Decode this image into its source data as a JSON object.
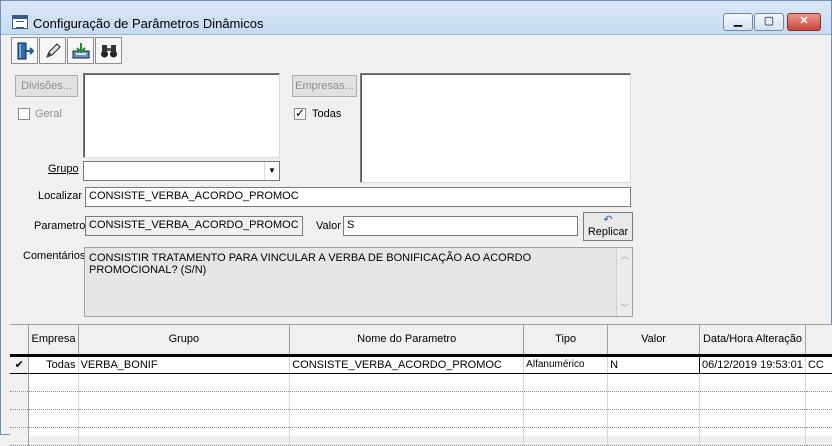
{
  "window": {
    "title": "Configuração de Parâmetros Dinâmicos",
    "min_label": "▁",
    "max_label": "▢",
    "close_label": "✕"
  },
  "toolbar": {
    "buttons": [
      {
        "icon": "exit-door-icon"
      },
      {
        "icon": "pencil-icon"
      },
      {
        "icon": "save-tray-icon"
      },
      {
        "icon": "binoculars-icon"
      }
    ]
  },
  "filters": {
    "divisoes_button": "Divisões...",
    "geral_label": "Geral",
    "geral_checked": false,
    "empresas_button": "Empresas...",
    "todas_label": "Todas",
    "todas_checked": true,
    "grupo_label": "Grupo",
    "grupo_value": "",
    "localizar_label": "Localizar",
    "localizar_value": "CONSISTE_VERBA_ACORDO_PROMOC",
    "parametro_label": "Parametro",
    "parametro_value": "CONSISTE_VERBA_ACORDO_PROMOC",
    "valor_label": "Valor",
    "valor_value": "S",
    "replicar_label": "Replicar",
    "comentarios_label": "Comentários",
    "comentarios_value": "CONSISTIR TRATAMENTO PARA VINCULAR A VERBA DE BONIFICAÇÃO AO ACORDO PROMOCIONAL? (S/N)"
  },
  "grid": {
    "columns": [
      "Empresa",
      "Grupo",
      "Nome do Parametro",
      "Tipo",
      "Valor",
      "Data/Hora Alteração",
      ""
    ],
    "rows": [
      {
        "indicator": "✔",
        "empresa": "Todas",
        "grupo": "VERBA_BONIF",
        "nome": "CONSISTE_VERBA_ACORDO_PROMOC",
        "tipo": "Alfanumérico",
        "valor": "N",
        "data": "06/12/2019 19:53:01",
        "extra": "CC"
      }
    ]
  },
  "colors": {
    "titlebar": "#c6daf0",
    "close_button": "#c9463a",
    "window_bg": "#f0f0f0"
  }
}
